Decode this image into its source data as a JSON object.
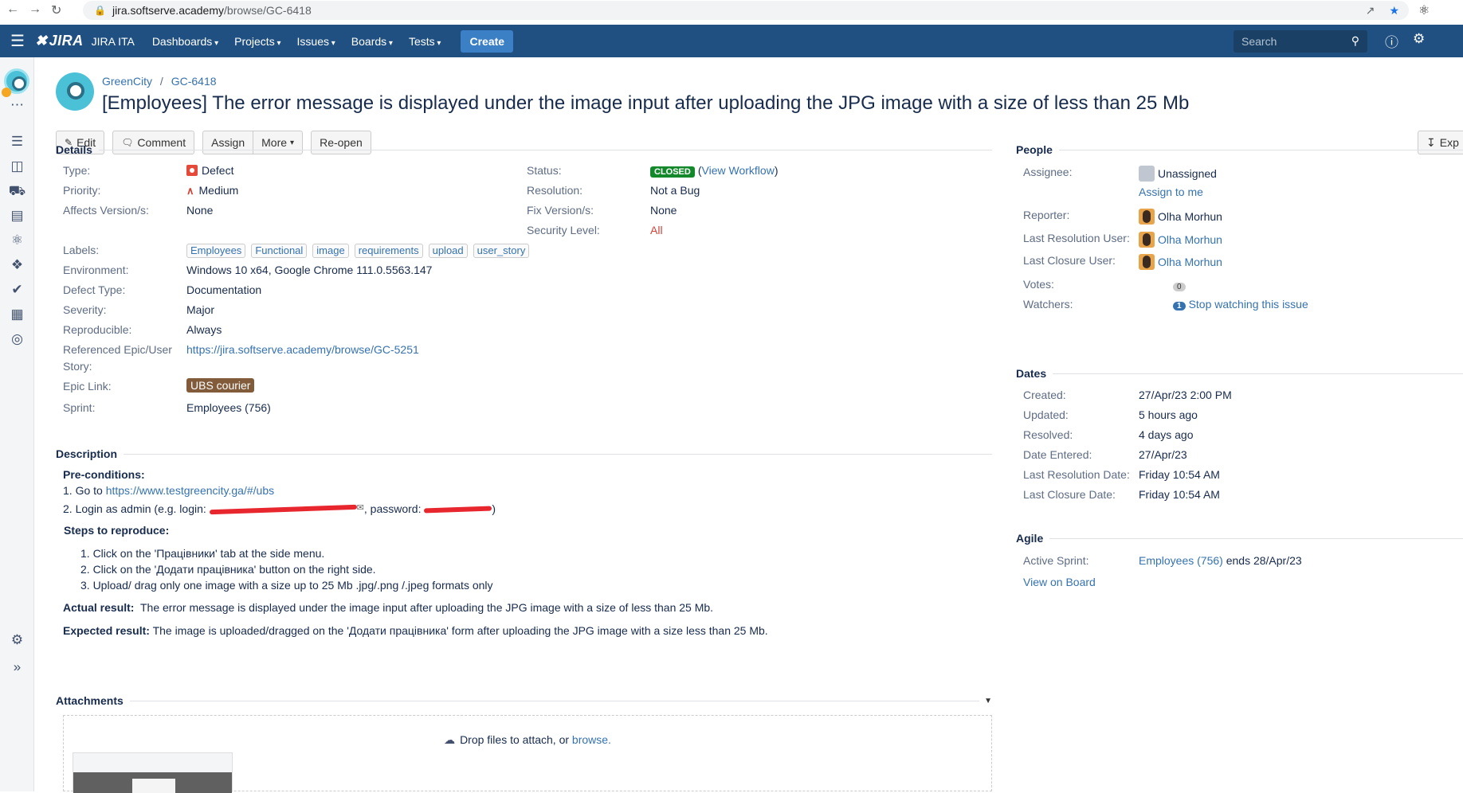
{
  "browser": {
    "url_host": "jira.softserve.academy",
    "url_path": "/browse/GC-6418"
  },
  "topbar": {
    "logo": "JIRA",
    "app_name": "JIRA ITA",
    "menu": [
      "Dashboards",
      "Projects",
      "Issues",
      "Boards",
      "Tests"
    ],
    "create": "Create",
    "search_placeholder": "Search"
  },
  "breadcrumb": {
    "project": "GreenCity",
    "separator": "/",
    "issue_key": "GC-6418"
  },
  "issue_title": "[Employees] The error message is displayed under the image input after uploading the JPG image with a size of less than 25 Mb",
  "toolbar": {
    "edit": "Edit",
    "comment": "Comment",
    "assign": "Assign",
    "more": "More",
    "reopen": "Re-open",
    "export": "Exp"
  },
  "details": {
    "heading": "Details",
    "type_label": "Type:",
    "type": "Defect",
    "priority_label": "Priority:",
    "priority": "Medium",
    "affects_label": "Affects Version/s:",
    "affects": "None",
    "status_label": "Status:",
    "status": "CLOSED",
    "view_workflow": "View Workflow",
    "resolution_label": "Resolution:",
    "resolution": "Not a Bug",
    "fix_label": "Fix Version/s:",
    "fix": "None",
    "security_label": "Security Level:",
    "security": "All",
    "labels_label": "Labels:",
    "labels": [
      "Employees",
      "Functional",
      "image",
      "requirements",
      "upload",
      "user_story"
    ],
    "environment_label": "Environment:",
    "environment": "Windows 10 x64, Google Chrome 111.0.5563.147",
    "defect_type_label": "Defect Type:",
    "defect_type": "Documentation",
    "severity_label": "Severity:",
    "severity": "Major",
    "reproducible_label": "Reproducible:",
    "reproducible": "Always",
    "ref_epic_label_1": "Referenced Epic/User",
    "ref_epic_label_2": "Story:",
    "ref_epic": "https://jira.softserve.academy/browse/GC-5251",
    "epic_link_label": "Epic Link:",
    "epic_link": "UBS courier",
    "sprint_label": "Sprint:",
    "sprint": "Employees (756)"
  },
  "description": {
    "heading": "Description",
    "preconditions": "Pre-conditions:",
    "step1_prefix": "1. Go to ",
    "step1_link": "https://www.testgreencity.ga/#/ubs",
    "step2_prefix": "2. Login as admin (e.g. login: ",
    "step2_mid": ", password: ",
    "step2_end": ")",
    "steps_heading": "Steps to reproduce:",
    "steps": [
      "1. Click on the 'Працівники' tab at the side menu.",
      "2. Click on the 'Додати працівника' button on the right side.",
      "3. Upload/ drag only one image with a size up to 25 Mb .jpg/.png /.jpeg formats only"
    ],
    "actual_label": "Actual result:",
    "actual": "The error message is displayed under the image input after uploading the JPG image with a size of less than 25 Mb.",
    "expected_label": "Expected result:",
    "expected": "The image is uploaded/dragged on the 'Додати працівника' form after uploading the JPG image with a size less than 25 Mb."
  },
  "attachments": {
    "heading": "Attachments",
    "drop_text": "Drop files to attach, or ",
    "browse": "browse."
  },
  "people": {
    "heading": "People",
    "assignee_label": "Assignee:",
    "assignee": "Unassigned",
    "assign_to_me": "Assign to me",
    "reporter_label": "Reporter:",
    "reporter": "Olha Morhun",
    "last_res_user_label": "Last Resolution User:",
    "last_res_user": "Olha Morhun",
    "last_closure_user_label": "Last Closure User:",
    "last_closure_user": "Olha Morhun",
    "votes_label": "Votes:",
    "votes": "0",
    "watchers_label": "Watchers:",
    "watchers": "1",
    "stop_watching": "Stop watching this issue"
  },
  "dates": {
    "heading": "Dates",
    "created_label": "Created:",
    "created": "27/Apr/23 2:00 PM",
    "updated_label": "Updated:",
    "updated": "5 hours ago",
    "resolved_label": "Resolved:",
    "resolved": "4 days ago",
    "entered_label": "Date Entered:",
    "entered": "27/Apr/23",
    "last_res_date_label": "Last Resolution Date:",
    "last_res_date": "Friday 10:54 AM",
    "last_closure_date_label": "Last Closure Date:",
    "last_closure_date": "Friday 10:54 AM"
  },
  "agile": {
    "heading": "Agile",
    "active_sprint_label": "Active Sprint:",
    "active_sprint": "Employees (756)",
    "ends": "ends 28/Apr/23",
    "view_on_board": "View on Board"
  }
}
